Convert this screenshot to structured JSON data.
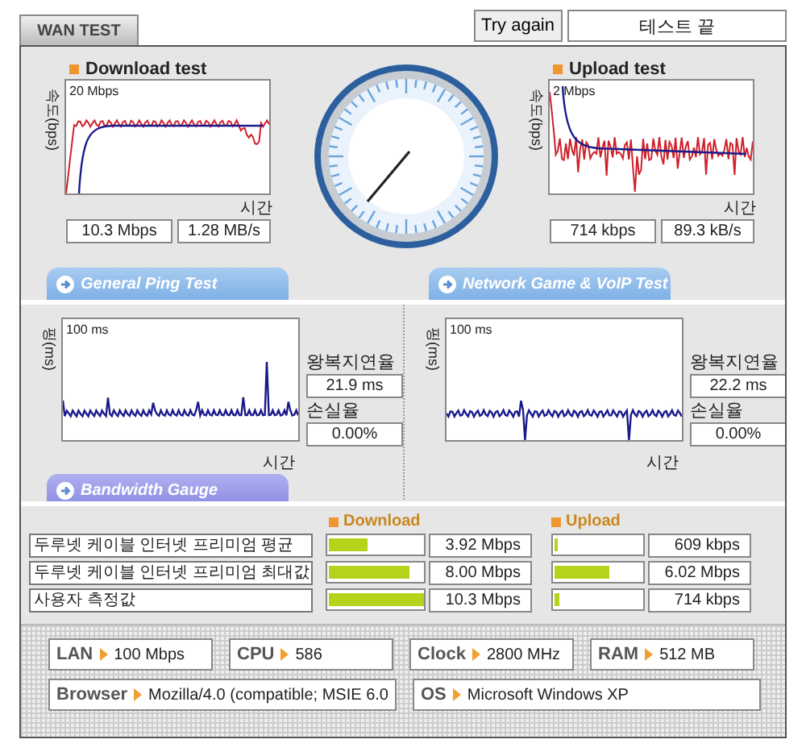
{
  "tab": {
    "label": "WAN TEST"
  },
  "retry_button": "Try again",
  "status": "테스트 끝",
  "speed_tests": [
    {
      "title": "Download test",
      "y_axis": "속도(bps)",
      "scale": "20 Mbps",
      "x_axis": "시간",
      "rate": "10.3 Mbps",
      "throughput": "1.28 MB/s"
    },
    {
      "title": "Upload test",
      "y_axis": "속도(bps)",
      "scale": "2 Mbps",
      "x_axis": "시간",
      "rate": "714 kbps",
      "throughput": "89.3 kB/s"
    }
  ],
  "ping_tests": [
    {
      "tab": "General Ping Test",
      "y_axis": "핑(ms)",
      "scale": "100 ms",
      "x_axis": "시간",
      "latency_label": "왕복지연율",
      "latency": "21.9 ms",
      "loss_label": "손실율",
      "loss": "0.00%"
    },
    {
      "tab": "Network Game & VoIP Test",
      "y_axis": "핑(ms)",
      "scale": "100 ms",
      "x_axis": "시간",
      "latency_label": "왕복지연율",
      "latency": "22.2 ms",
      "loss_label": "손실율",
      "loss": "0.00%"
    }
  ],
  "bandwidth": {
    "tab": "Bandwidth Gauge",
    "download_header": "Download",
    "upload_header": "Upload",
    "rows": [
      {
        "label": "두루넷 케이블 인터넷 프리미엄 평균",
        "download": {
          "level": 0.41,
          "value": "3.92 Mbps"
        },
        "upload": {
          "level": 0.04,
          "value": "609 kbps"
        }
      },
      {
        "label": "두루넷 케이블 인터넷 프리미엄 최대값",
        "download": {
          "level": 0.84,
          "value": "8.00 Mbps"
        },
        "upload": {
          "level": 0.61,
          "value": "6.02 Mbps"
        }
      },
      {
        "label": "사용자 측정값",
        "download": {
          "level": 1,
          "value": "10.3 Mbps"
        },
        "upload": {
          "level": 0.06,
          "value": "714 kbps"
        }
      }
    ]
  },
  "system_info": [
    [
      {
        "label": "LAN",
        "value": "100 Mbps"
      },
      {
        "label": "CPU",
        "value": "586"
      },
      {
        "label": "Clock",
        "value": "2800 MHz"
      },
      {
        "label": "RAM",
        "value": "512 MB"
      }
    ],
    [
      {
        "label": "Browser",
        "value": "Mozilla/4.0 (compatible; MSIE 6.0"
      },
      {
        "label": "OS",
        "value": "Microsoft Windows XP"
      }
    ]
  ]
}
